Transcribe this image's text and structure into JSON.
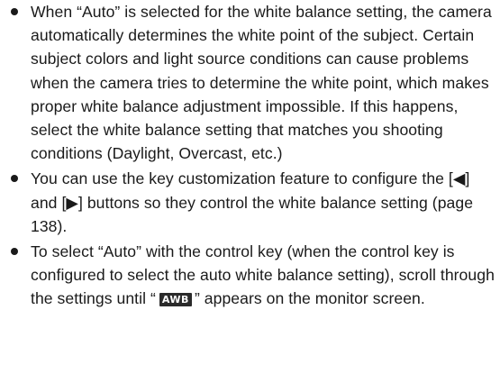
{
  "bullets": [
    {
      "text": "When “Auto” is selected for the white balance setting, the camera automatically determines the white point of the subject. Certain subject colors and light source conditions can cause problems when the camera tries to determine the white point, which makes proper white balance adjustment impossible. If this happens, select the white balance setting that matches you shooting conditions (Daylight, Overcast, etc.)"
    },
    {
      "text": "You can use the key customization feature to configure the [◀] and [▶] buttons so they control the white balance setting (page 138)."
    },
    {
      "text_before_icon": "To select “Auto” with the control key (when the control key is configured to select the auto white balance setting), scroll through the settings until “",
      "icon_label": "AWB",
      "text_after_icon": "” appears on the monitor screen."
    }
  ],
  "colors": {
    "text": "#1a1a1a",
    "icon_background": "#2b2b2b",
    "icon_text": "#ffffff"
  },
  "icons": {
    "bullet": "bullet-dot",
    "awb": "auto-white-balance-icon"
  }
}
